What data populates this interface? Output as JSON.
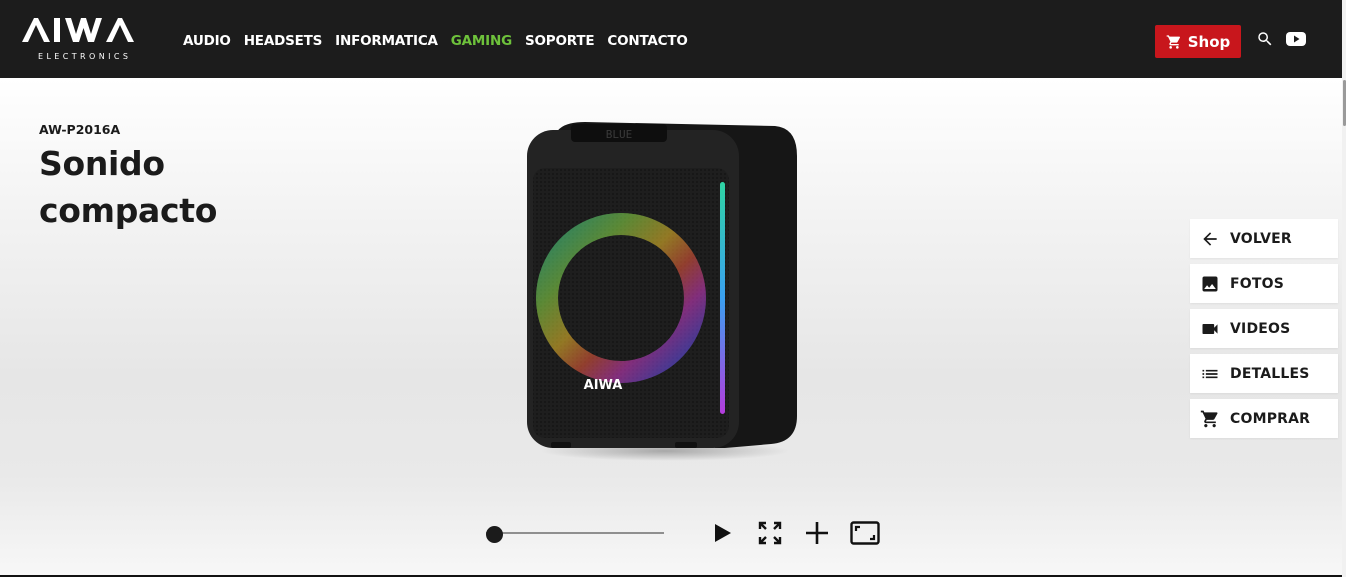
{
  "header": {
    "logo_text": "AIWA",
    "logo_sub": "ELECTRONICS",
    "nav": [
      {
        "label": "AUDIO",
        "active": false
      },
      {
        "label": "HEADSETS",
        "active": false
      },
      {
        "label": "INFORMATICA",
        "active": false
      },
      {
        "label": "GAMING",
        "active": true
      },
      {
        "label": "SOPORTE",
        "active": false
      },
      {
        "label": "CONTACTO",
        "active": false
      }
    ],
    "shop_label": "Shop",
    "icons": {
      "cart": "cart-icon",
      "search": "search-icon",
      "youtube": "youtube-icon"
    }
  },
  "product": {
    "model": "AW-P2016A",
    "title": "Sonido compacto",
    "brand_on_device": "AIWA",
    "display_text": "BLUE"
  },
  "side_menu": [
    {
      "label": "VOLVER",
      "icon": "arrow-left-icon"
    },
    {
      "label": "FOTOS",
      "icon": "image-icon"
    },
    {
      "label": "VIDEOS",
      "icon": "video-camera-icon"
    },
    {
      "label": "DETALLES",
      "icon": "list-icon"
    },
    {
      "label": "COMPRAR",
      "icon": "cart-icon"
    }
  ],
  "viewer": {
    "rotation_slider_value": 0.05,
    "icons": [
      "play-icon",
      "expand-icon",
      "zoom-in-icon",
      "fullscreen-icon"
    ]
  },
  "colors": {
    "header_bg": "#1c1c1c",
    "accent_green": "#6ec23b",
    "shop_red": "#c8161c"
  }
}
